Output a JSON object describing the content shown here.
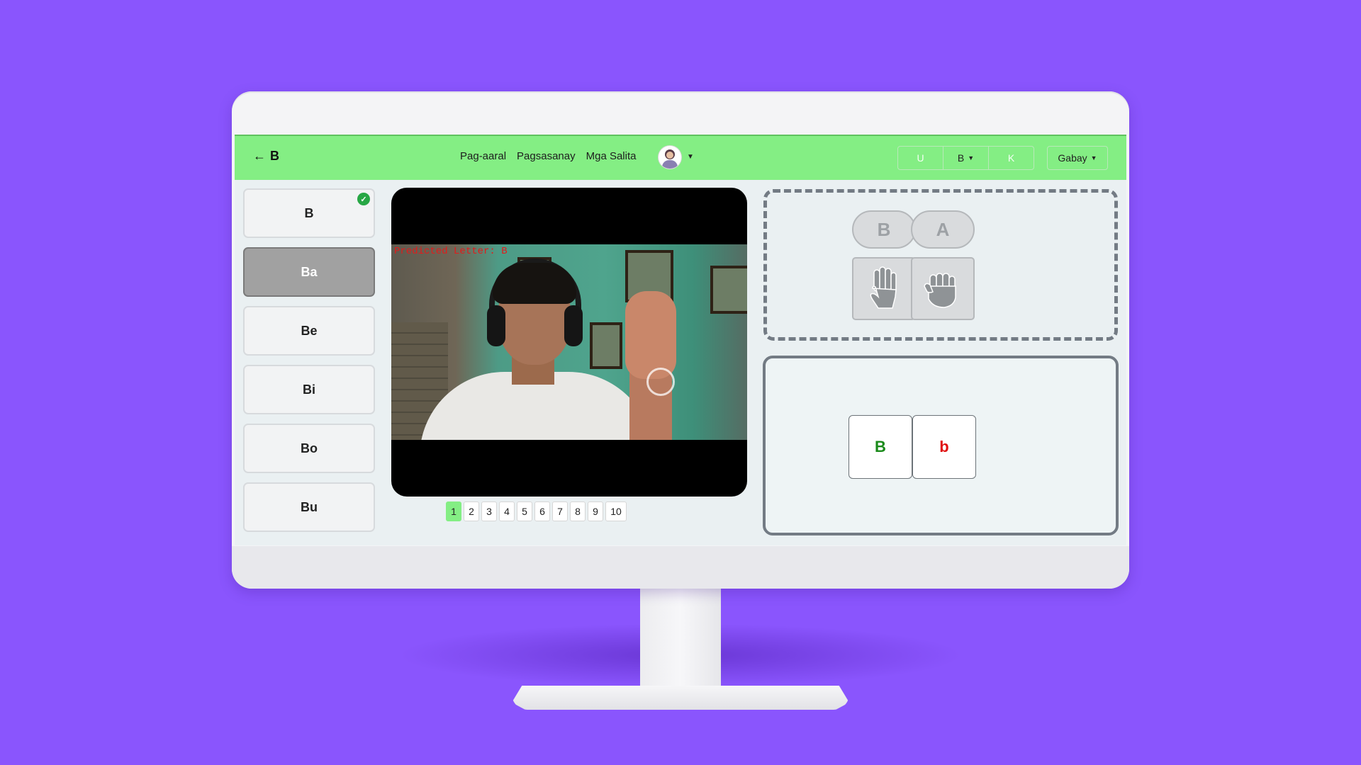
{
  "navbar": {
    "back_label": "B",
    "links": [
      "Pag-aaral",
      "Pagsasanay",
      "Mga Salita"
    ],
    "group_buttons": [
      "U",
      "B",
      "K"
    ],
    "gabay_label": "Gabay"
  },
  "sidebar": {
    "items": [
      {
        "label": "B",
        "completed": true
      },
      {
        "label": "Ba",
        "selected": true
      },
      {
        "label": "Be"
      },
      {
        "label": "Bi"
      },
      {
        "label": "Bo"
      },
      {
        "label": "Bu"
      }
    ]
  },
  "video": {
    "predicted_text": "Predicted Letter: B"
  },
  "pagination": {
    "pages": [
      "1",
      "2",
      "3",
      "4",
      "5",
      "6",
      "7",
      "8",
      "9",
      "10"
    ],
    "current": "1"
  },
  "guide": {
    "letters": [
      "B",
      "A"
    ],
    "hand_icons": [
      "hand-sign-b-icon",
      "hand-sign-a-icon"
    ]
  },
  "answer": {
    "upper": "B",
    "lower": "b",
    "upper_color": "#1a8a1a",
    "lower_color": "#e01010"
  },
  "colors": {
    "background": "#8a55fd",
    "navbar": "#84ee84",
    "check": "#28a745"
  }
}
